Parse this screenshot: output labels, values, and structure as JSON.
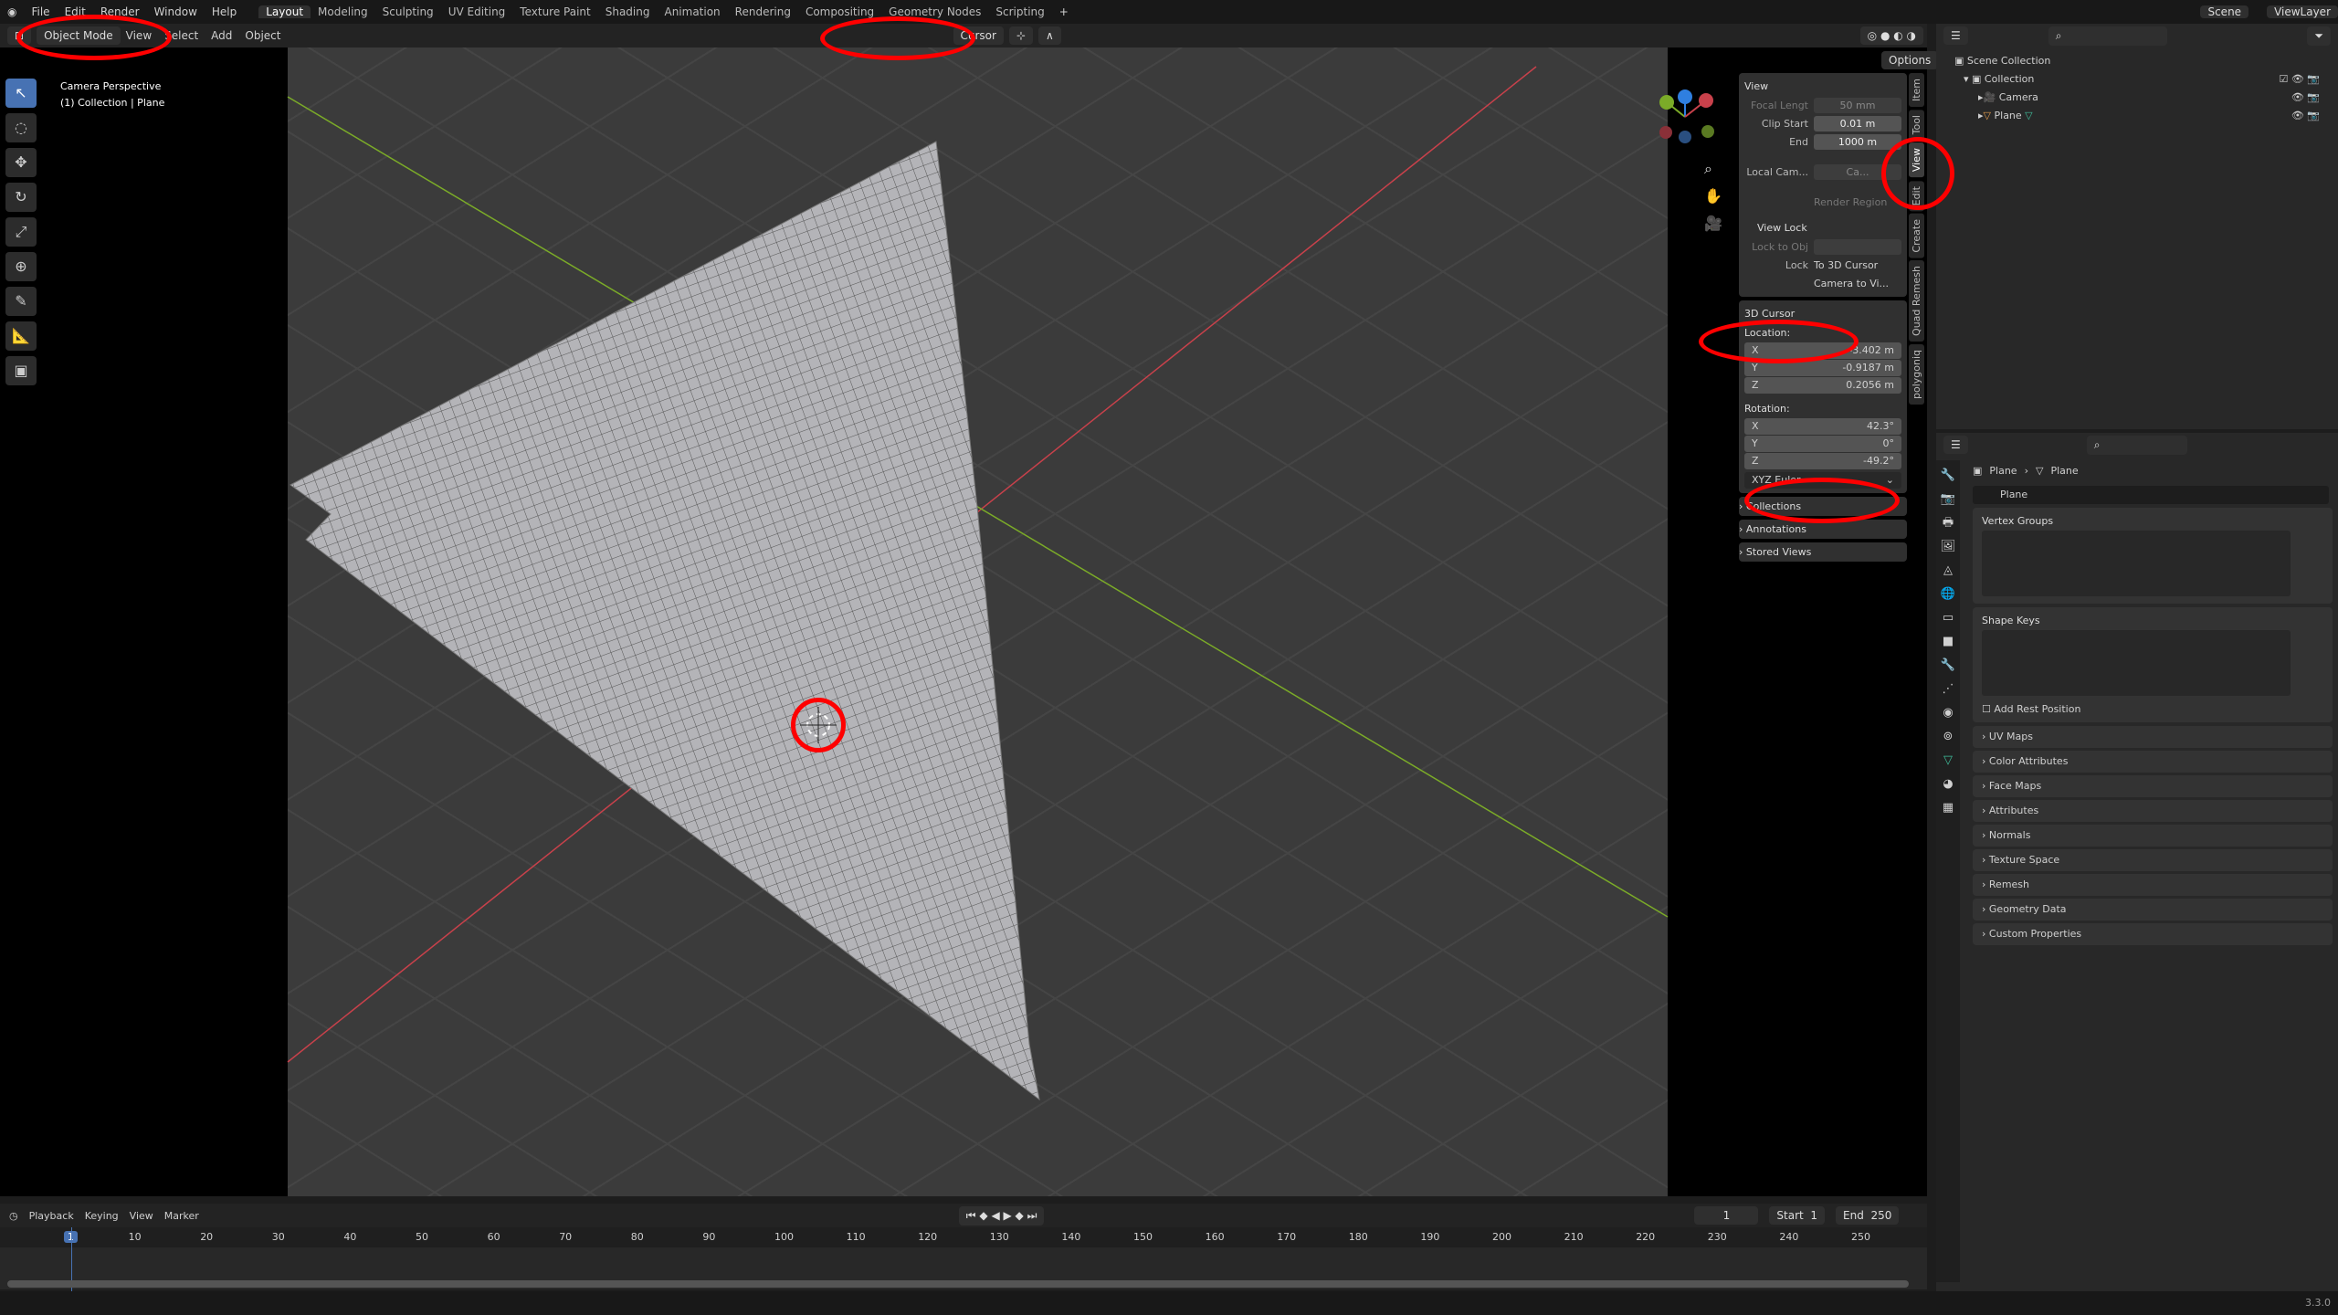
{
  "menubar": {
    "items": [
      "File",
      "Edit",
      "Render",
      "Window",
      "Help"
    ],
    "workspaces": [
      "Layout",
      "Modeling",
      "Sculpting",
      "UV Editing",
      "Texture Paint",
      "Shading",
      "Animation",
      "Rendering",
      "Compositing",
      "Geometry Nodes",
      "Scripting"
    ],
    "active_workspace": "Layout",
    "scene": "Scene",
    "view_layer": "ViewLayer"
  },
  "viewport_header": {
    "mode": "Object Mode",
    "menus": [
      "View",
      "Select",
      "Add",
      "Object"
    ],
    "transform_pivot": "Cursor",
    "options": "Options"
  },
  "viewport": {
    "overlay_line1": "Camera Perspective",
    "overlay_line2": "(1) Collection | Plane",
    "gizmo_axes": [
      "X",
      "Y",
      "Z"
    ]
  },
  "npanel": {
    "tabs": [
      "Item",
      "Tool",
      "View",
      "Edit",
      "Create",
      "Quad Remesh",
      "polygoniq"
    ],
    "active_tab": "View",
    "view": {
      "title": "View",
      "focal_label": "Focal Lengt",
      "focal": "50 mm",
      "clip_start_label": "Clip Start",
      "clip_start": "0.01 m",
      "end_label": "End",
      "end": "1000 m",
      "local_cam_label": "Local Cam...",
      "local_cam": "Ca...",
      "render_region": "Render Region"
    },
    "view_lock": {
      "title": "View Lock",
      "lock_to_obj": "Lock to Obj",
      "lock": "Lock",
      "to_cursor": "To 3D Cursor",
      "cam_to_view": "Camera to Vi..."
    },
    "cursor": {
      "title": "3D Cursor",
      "location_label": "Location:",
      "loc": [
        [
          "X",
          "-3.402 m"
        ],
        [
          "Y",
          "-0.9187 m"
        ],
        [
          "Z",
          "0.2056 m"
        ]
      ],
      "rotation_label": "Rotation:",
      "rot": [
        [
          "X",
          "42.3°"
        ],
        [
          "Y",
          "0°"
        ],
        [
          "Z",
          "-49.2°"
        ]
      ],
      "mode": "XYZ Euler"
    },
    "collapsed": [
      "Collections",
      "Annotations",
      "Stored Views"
    ]
  },
  "outliner": {
    "root": "Scene Collection",
    "collection": "Collection",
    "items": [
      "Camera",
      "Plane"
    ]
  },
  "properties": {
    "breadcrumb": [
      "Plane",
      "Plane"
    ],
    "data_name": "Plane",
    "vertex_groups": "Vertex Groups",
    "shape_keys": "Shape Keys",
    "add_rest": "Add Rest Position",
    "sections": [
      "UV Maps",
      "Color Attributes",
      "Face Maps",
      "Attributes",
      "Normals",
      "Texture Space",
      "Remesh",
      "Geometry Data",
      "Custom Properties"
    ],
    "tab_icons": [
      "tool-icon",
      "render-icon",
      "output-icon",
      "view-layer-icon",
      "scene-icon",
      "world-icon",
      "collection-icon",
      "object-icon",
      "modifier-icon",
      "particles-icon",
      "physics-icon",
      "constraints-icon",
      "mesh-data-icon",
      "material-icon",
      "texture-icon"
    ]
  },
  "timeline": {
    "menus": [
      "Playback",
      "Keying",
      "View",
      "Marker"
    ],
    "current": "1",
    "start_label": "Start",
    "start": "1",
    "end_label": "End",
    "end": "250",
    "ticks": [
      "1",
      "10",
      "20",
      "30",
      "40",
      "50",
      "60",
      "70",
      "80",
      "90",
      "100",
      "110",
      "120",
      "130",
      "140",
      "150",
      "160",
      "170",
      "180",
      "190",
      "200",
      "210",
      "220",
      "230",
      "240",
      "250"
    ]
  },
  "status": {
    "version": "3.3.0"
  },
  "colors": {
    "accent": "#4772b3",
    "x_axis": "#c8414b",
    "y_axis": "#7bab28",
    "annotation": "#ff0000"
  }
}
